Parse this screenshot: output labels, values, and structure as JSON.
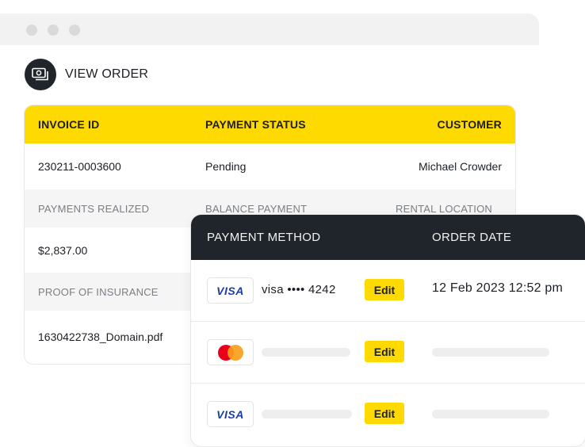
{
  "window": {
    "controls": [
      "close",
      "minimize",
      "maximize"
    ]
  },
  "order": {
    "title": "VIEW ORDER",
    "icon": "money-icon"
  },
  "invoice_card": {
    "header": {
      "invoice_id": "INVOICE ID",
      "payment_status": "PAYMENT STATUS",
      "customer": "CUSTOMER"
    },
    "values_1": {
      "invoice_id": "230211-0003600",
      "payment_status": "Pending",
      "customer": "Michael Crowder"
    },
    "labels_2": {
      "payments_realized": "PAYMENTS REALIZED",
      "balance_payment": "BALANCE PAYMENT",
      "rental_location": "RENTAL LOCATION"
    },
    "values_2": {
      "payments_realized": "$2,837.00"
    },
    "labels_3": {
      "proof_of_insurance": "PROOF OF INSURANCE"
    },
    "values_3": {
      "proof_of_insurance": "1630422738_Domain.pdf"
    }
  },
  "payment_card": {
    "header": {
      "payment_method": "PAYMENT METHOD",
      "order_date": "ORDER DATE"
    },
    "rows": [
      {
        "card_brand": "VISA",
        "card_number": "visa •••• 4242",
        "edit_label": "Edit",
        "order_date": "12 Feb 2023 12:52 pm"
      },
      {
        "card_brand": "mastercard",
        "edit_label": "Edit"
      },
      {
        "card_brand": "VISA",
        "edit_label": "Edit"
      }
    ]
  },
  "colors": {
    "accent": "#ffda00",
    "dark": "#1f252b",
    "visa": "#1a3ea6",
    "mastercard_red": "#eb001b",
    "mastercard_orange": "#f79e1b"
  }
}
